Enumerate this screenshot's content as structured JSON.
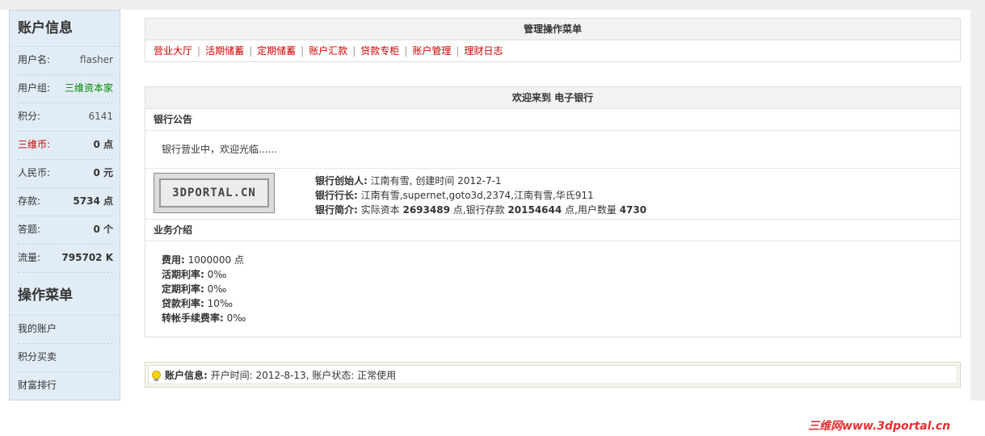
{
  "sidebar": {
    "account_title": "账户信息",
    "rows": [
      {
        "label": "用户名:",
        "value": "flasher"
      },
      {
        "label": "用户组:",
        "value": "三维资本家"
      },
      {
        "label": "积分:",
        "value": "6141"
      },
      {
        "label": "三维币:",
        "value": "0 点"
      },
      {
        "label": "人民币:",
        "value": "0 元"
      },
      {
        "label": "存款:",
        "value": "5734 点"
      },
      {
        "label": "答题:",
        "value": "0 个"
      },
      {
        "label": "流量:",
        "value": "795702 K"
      }
    ],
    "menu_title": "操作菜单",
    "menu_items": [
      "我的账户",
      "积分买卖",
      "财富排行"
    ]
  },
  "ops_menu": {
    "title": "管理操作菜单",
    "links": [
      "营业大厅",
      "活期储蓄",
      "定期储蓄",
      "账户汇款",
      "贷款专柜",
      "账户管理",
      "理财日志"
    ],
    "separator": "|"
  },
  "welcome": {
    "title": "欢迎来到 电子银行",
    "notice_heading": "银行公告",
    "notice_text": "银行营业中，欢迎光临......",
    "logo_text": "3DPORTAL.CN",
    "founder_label": "银行创始人:",
    "founder_value": "江南有雪, 创建时间 2012-7-1",
    "president_label": "银行行长:",
    "president_value": "江南有雪,supernet,goto3d,2374,江南有雪,华氏911",
    "summary_label": "银行简介:",
    "summary_capital_text": "实际资本",
    "summary_capital": "2693489",
    "summary_deposit_text": "点,银行存款",
    "summary_deposit": "20154644",
    "summary_users_text": "点,用户数量",
    "summary_users": "4730",
    "business_heading": "业务介绍",
    "fees": [
      {
        "label": "费用:",
        "value": "1000000 点"
      },
      {
        "label": "活期利率:",
        "value": "0‰"
      },
      {
        "label": "定期利率:",
        "value": "0‰"
      },
      {
        "label": "贷款利率:",
        "value": "10‰"
      },
      {
        "label": "转帐手续费率:",
        "value": "0‰"
      }
    ]
  },
  "status": {
    "label": "账户信息:",
    "text": "开户时间: 2012-8-13, 账户状态: 正常使用"
  },
  "watermark": "三维网www.3dportal.cn",
  "colors": {
    "link_red": "#cc0000",
    "group_green": "#008800",
    "sidebar_bg": "#e2ecf6"
  }
}
